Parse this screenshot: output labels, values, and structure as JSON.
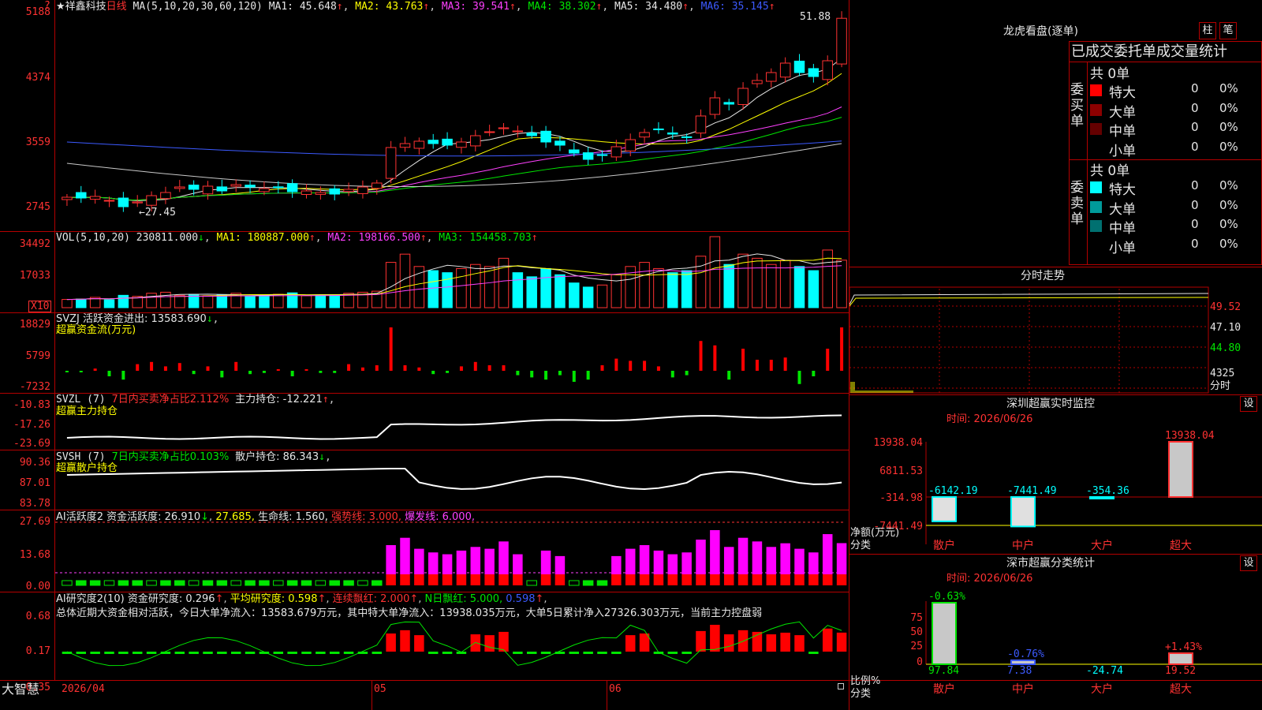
{
  "header": {
    "stock_name": "★祥鑫科技",
    "period": "日线",
    "ma_params": "MA(5,10,20,30,60,120)",
    "ma1": "MA1: 45.648",
    "ma2": "MA2: 43.763",
    "ma3": "MA3: 39.541",
    "ma4": "MA4: 38.302",
    "ma5": "MA5: 34.480",
    "ma6": "MA6: 35.145",
    "up_arrow": "↑",
    "down_arrow": "↓",
    "last_price": "51.88",
    "low_marker": "←27.45",
    "corner_q": "?"
  },
  "price_axis": [
    "5188",
    "4374",
    "3559",
    "2745"
  ],
  "vol": {
    "label": "VOL(5,10,20)",
    "value": "230811.000",
    "ma1": "MA1: 180887.000",
    "ma2": "MA2: 198166.500",
    "ma3": "MA3: 154458.703",
    "axis": [
      "34492",
      "17033"
    ],
    "unit": "X10"
  },
  "svzj": {
    "label": "SVZJ  活跃资金进出: 13583.690",
    "sub": "超赢资金流(万元)",
    "axis": [
      "18829",
      "5799",
      "-7232"
    ]
  },
  "svzl": {
    "label": "SVZL  (7)",
    "ratio": "7日内买卖净占比2.112%",
    "holding": "主力持仓: -12.221",
    "sub": "超赢主力持仓",
    "axis": [
      "-10.83",
      "-17.26",
      "-23.69"
    ]
  },
  "svsh": {
    "label": "SVSH  (7)",
    "ratio": "7日内买卖净占比0.103%",
    "holding": "散户持仓: 86.343",
    "sub": "超赢散户持仓",
    "axis": [
      "90.36",
      "87.01",
      "83.78"
    ]
  },
  "ai_active": {
    "label": "AI活跃度2",
    "v1": "资金活跃度: 26.910",
    "v2": "27.685,",
    "v3": "生命线: 1.560,",
    "v4": "强势线: 3.000,",
    "v5": "爆发线: 6.000,",
    "axis": [
      "27.69",
      "13.68",
      "0.00"
    ]
  },
  "ai_research": {
    "label": "AI研究度2(10)",
    "v1": "资金研究度: 0.296",
    "v2": "平均研究度: 0.598",
    "v3": "连续飘红: 2.000",
    "v4": "N日飘红: 5.000,",
    "v5": "0.598",
    "summary": "总体近期大资金相对活跃，今日大单净流入：13583.679万元，其中特大单净流入：13938.035万元，大单5日累计净入27326.303万元，当前主力控盘弱",
    "axis": [
      "0.68",
      "0.17",
      "-0.35"
    ]
  },
  "bottom_axis": {
    "brand": "大智慧",
    "date": "2026/04",
    "m05": "05",
    "m06": "06"
  },
  "dragon": {
    "title": "龙虎看盘(逐单)",
    "btn_bar": "柱",
    "btn_pen": "笔",
    "headline": "已成交委托单成交量统计",
    "buy_label": "委买单",
    "sell_label": "委卖单",
    "buy_total": "共 0单",
    "sell_total": "共 0单",
    "buy_rows": [
      {
        "name": "特大",
        "count": "0",
        "pct": "0%",
        "color": "#ff0000"
      },
      {
        "name": "大单",
        "count": "0",
        "pct": "0%",
        "color": "#8c0000"
      },
      {
        "name": "中单",
        "count": "0",
        "pct": "0%",
        "color": "#640000"
      },
      {
        "name": "小单",
        "count": "0",
        "pct": "0%",
        "color": ""
      }
    ],
    "sell_rows": [
      {
        "name": "特大",
        "count": "0",
        "pct": "0%",
        "color": "#00ffff"
      },
      {
        "name": "大单",
        "count": "0",
        "pct": "0%",
        "color": "#009a9a"
      },
      {
        "name": "中单",
        "count": "0",
        "pct": "0%",
        "color": "#007070"
      },
      {
        "name": "小单",
        "count": "0",
        "pct": "0%",
        "color": ""
      }
    ]
  },
  "intraday": {
    "title": "分时走势",
    "axis": [
      "49.52",
      "47.10",
      "44.80",
      "4325"
    ],
    "tag": "分时"
  },
  "realtime": {
    "title": "深圳超赢实时监控",
    "btn": "设",
    "time": "时间: 2026/06/26",
    "axis": [
      "13938.04",
      "6811.53",
      "-314.98",
      "-7441.49"
    ],
    "values": [
      "-6142.19",
      "-7441.49",
      "-354.36",
      "13938.04"
    ],
    "ylabel": "净额(万元)",
    "xlabel": "分类",
    "categories": [
      "散户",
      "中户",
      "大户",
      "超大"
    ]
  },
  "classify": {
    "title": "深市超赢分类统计",
    "btn": "设",
    "time": "时间: 2026/06/26",
    "axis": [
      "75",
      "50",
      "25",
      "0"
    ],
    "top_values": [
      "-0.63%",
      "-0.76%",
      "",
      "+1.43%"
    ],
    "bottom_values": [
      "97.84",
      "7.38",
      "-24.74",
      "19.52"
    ],
    "ylabel": "比例%",
    "xlabel": "分类",
    "categories": [
      "散户",
      "中户",
      "大户",
      "超大"
    ]
  },
  "chart_data": {
    "type": "candlestick",
    "title": "祥鑫科技 日线",
    "price_ylim": [
      27.45,
      51.88
    ],
    "candles_close": [
      29.2,
      29.1,
      29.3,
      28.8,
      28.0,
      28.6,
      29.4,
      29.8,
      30.5,
      30.2,
      30.6,
      30.0,
      30.8,
      30.5,
      30.3,
      30.4,
      29.9,
      30.0,
      29.8,
      29.6,
      30.2,
      30.5,
      31.0,
      35.5,
      36.0,
      36.3,
      36.0,
      35.8,
      36.2,
      37.0,
      37.5,
      38.0,
      37.6,
      37.0,
      36.2,
      35.8,
      34.8,
      34.0,
      34.5,
      35.6,
      36.5,
      37.4,
      37.8,
      37.2,
      36.8,
      39.5,
      41.8,
      41.0,
      43.0,
      44.0,
      45.0,
      46.2,
      45.0,
      44.5,
      46.5,
      51.88
    ],
    "volume_x10": [
      4000,
      4200,
      5000,
      3800,
      6000,
      5500,
      7000,
      7500,
      6000,
      6500,
      5800,
      6200,
      7000,
      5500,
      6000,
      6500,
      7200,
      5800,
      6000,
      6200,
      7000,
      7500,
      8000,
      22000,
      26000,
      20000,
      18000,
      17000,
      19000,
      21000,
      20000,
      24000,
      17000,
      15000,
      19000,
      16000,
      12000,
      10000,
      11000,
      16000,
      20000,
      22000,
      19000,
      17000,
      18000,
      25000,
      34492,
      21000,
      26000,
      24000,
      21000,
      23000,
      20000,
      18000,
      28000,
      23081
    ]
  }
}
